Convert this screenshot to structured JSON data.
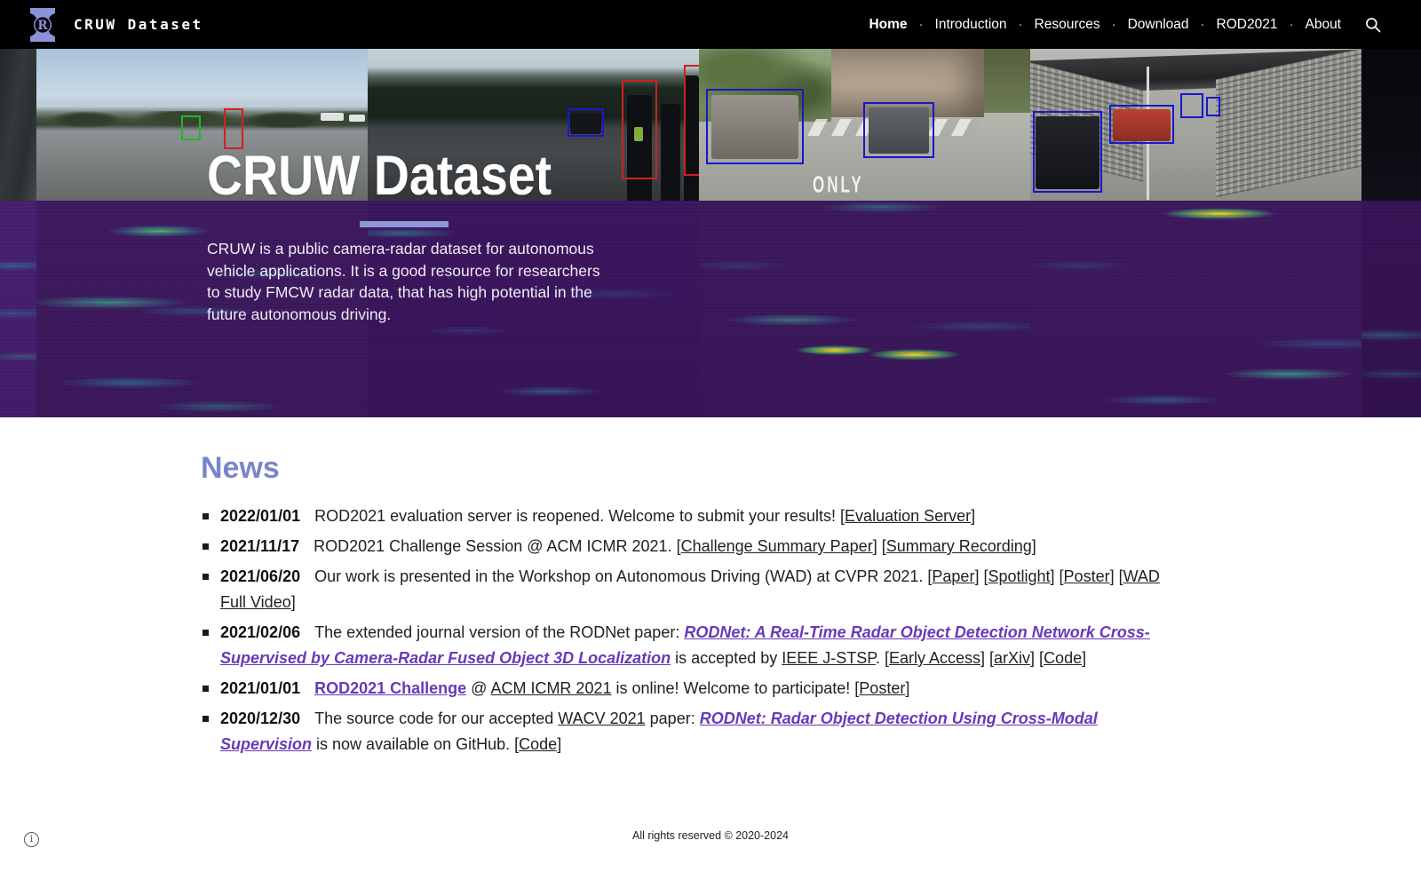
{
  "navbar": {
    "title": "CRUW Dataset",
    "separator": "·",
    "items": [
      {
        "label": "Home",
        "active": true
      },
      {
        "label": "Introduction",
        "active": false
      },
      {
        "label": "Resources",
        "active": false
      },
      {
        "label": "Download",
        "active": false
      },
      {
        "label": "ROD2021",
        "active": false
      },
      {
        "label": "About",
        "active": false
      }
    ],
    "search_icon": "search-icon",
    "logo_icon": "cruw-logo-icon"
  },
  "hero": {
    "title": "CRUW Dataset",
    "description": "CRUW is a public camera-radar dataset for autonomous vehicle applications. It is a good resource for researchers to study FMCW radar data, that has high potential in the future autonomous driving.",
    "road_marking": "ONLY",
    "accent_color": "#8e97d8"
  },
  "news": {
    "heading": "News",
    "heading_color": "#7986cb",
    "link_purple": "#673ab7",
    "items": [
      {
        "date": "2022/01/01",
        "segments": [
          {
            "style": "text",
            "text": "ROD2021 evaluation server is reopened. Welcome to submit your results! ["
          },
          {
            "style": "link",
            "text": "Evaluation Server"
          },
          {
            "style": "text",
            "text": "]"
          }
        ]
      },
      {
        "date": "2021/11/17",
        "segments": [
          {
            "style": "text",
            "text": "ROD2021 Challenge Session @ ACM ICMR 2021. ["
          },
          {
            "style": "link",
            "text": "Challenge Summary Paper"
          },
          {
            "style": "text",
            "text": "] ["
          },
          {
            "style": "link",
            "text": "Summary Recording"
          },
          {
            "style": "text",
            "text": "]"
          }
        ]
      },
      {
        "date": "2021/06/20",
        "segments": [
          {
            "style": "text",
            "text": "Our work is presented in the Workshop on Autonomous Driving (WAD) at CVPR 2021. ["
          },
          {
            "style": "link",
            "text": "Paper"
          },
          {
            "style": "text",
            "text": "] ["
          },
          {
            "style": "link",
            "text": "Spotlight"
          },
          {
            "style": "text",
            "text": "] ["
          },
          {
            "style": "link",
            "text": "Poster"
          },
          {
            "style": "text",
            "text": "] ["
          },
          {
            "style": "link",
            "text": "WAD Full Video"
          },
          {
            "style": "text",
            "text": "]"
          }
        ]
      },
      {
        "date": "2021/02/06",
        "segments": [
          {
            "style": "text",
            "text": "The extended journal version of the RODNet paper: "
          },
          {
            "style": "link-purple-bold-italic",
            "text": "RODNet: A Real-Time Radar Object Detection Network Cross-Supervised by Camera-Radar Fused Object 3D Localization"
          },
          {
            "style": "text",
            "text": " is accepted by "
          },
          {
            "style": "link",
            "text": "IEEE J-STSP"
          },
          {
            "style": "text",
            "text": ". ["
          },
          {
            "style": "link",
            "text": "Early Access"
          },
          {
            "style": "text",
            "text": "] ["
          },
          {
            "style": "link",
            "text": "arXiv"
          },
          {
            "style": "text",
            "text": "] ["
          },
          {
            "style": "link",
            "text": "Code"
          },
          {
            "style": "text",
            "text": "]"
          }
        ]
      },
      {
        "date": "2021/01/01",
        "segments": [
          {
            "style": "link-purple-bold",
            "text": "ROD2021 Challenge"
          },
          {
            "style": "text",
            "text": " @ "
          },
          {
            "style": "link",
            "text": "ACM ICMR 2021"
          },
          {
            "style": "text",
            "text": " is online! Welcome to participate! ["
          },
          {
            "style": "link",
            "text": "Poster"
          },
          {
            "style": "text",
            "text": "]"
          }
        ]
      },
      {
        "date": "2020/12/30",
        "segments": [
          {
            "style": "text",
            "text": "The source code for our accepted "
          },
          {
            "style": "link",
            "text": "WACV 2021"
          },
          {
            "style": "text",
            "text": " paper: "
          },
          {
            "style": "link-purple-bold-italic",
            "text": "RODNet: Radar Object Detection Using Cross-Modal Supervision"
          },
          {
            "style": "text",
            "text": " is now available on GitHub. ["
          },
          {
            "style": "link",
            "text": "Code"
          },
          {
            "style": "text",
            "text": "]"
          }
        ]
      }
    ]
  },
  "footer": {
    "copyright": "All rights reserved © 2020-2024",
    "info_icon": "info-icon"
  }
}
